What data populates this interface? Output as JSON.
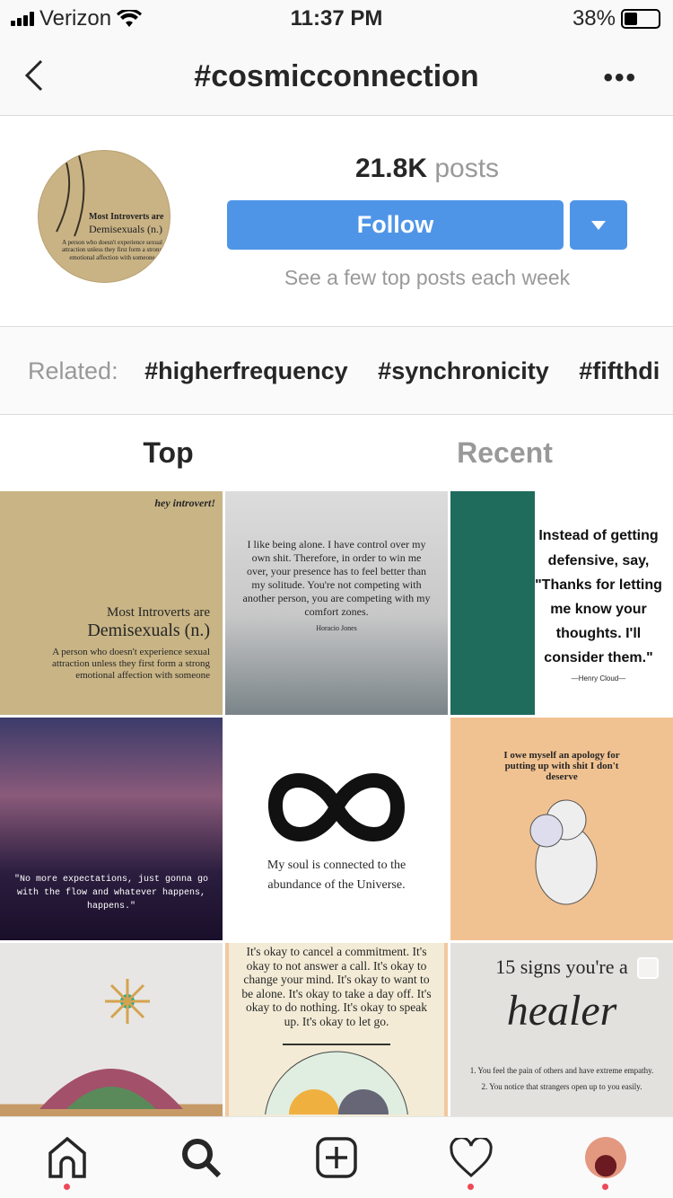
{
  "status_bar": {
    "carrier": "Verizon",
    "time": "11:37 PM",
    "battery": "38%",
    "battery_level": 0.38
  },
  "header": {
    "title": "#cosmicconnection",
    "back_icon": "chevron-left-icon",
    "more_icon": "ellipsis-icon"
  },
  "profile": {
    "avatar_text": [
      "Most Introverts are",
      "Demisexuals (n.)",
      "A person who doesn't experience sexual attraction unless they first form a strong emotional affection with someone"
    ],
    "post_count": "21.8K",
    "posts_label": "posts",
    "follow_label": "Follow",
    "subtitle": "See a few top posts each week",
    "accent": "#4e95e8"
  },
  "related": {
    "label": "Related:",
    "tags": [
      "#higherfrequency",
      "#synchronicity",
      "#fifthdi"
    ]
  },
  "tabs": [
    {
      "label": "Top",
      "active": true
    },
    {
      "label": "Recent",
      "active": false
    }
  ],
  "grid": [
    {
      "tag": "hey introvert!",
      "title": "Most Introverts are",
      "title2": "Demisexuals (n.)",
      "text": "A person who doesn't experience sexual attraction unless they first form a strong emotional affection with someone"
    },
    {
      "text": "I like being alone. I have control over my own shit. Therefore, in order to win me over, your presence has to feel better than my solitude. You're not competing with another person, you are competing with my comfort zones.",
      "author": "Horacio Jones"
    },
    {
      "text": "Instead of getting defensive, say, \"Thanks for letting me know your thoughts. I'll consider them.\"",
      "author": "—Henry Cloud—"
    },
    {
      "text": "\"No more expectations, just gonna go with the flow and whatever happens, happens.\""
    },
    {
      "text": "My soul is connected to the abundance of the Universe."
    },
    {
      "text": "I owe myself an apology for putting up with shit I don't deserve"
    },
    {
      "text": ""
    },
    {
      "text": "It's okay to cancel a commitment. It's okay to not answer a call. It's okay to change your mind. It's okay to want to be alone. It's okay to take a day off. It's okay to do nothing. It's okay to speak up. It's okay to let go."
    },
    {
      "title": "15 signs you're a",
      "script": "healer",
      "line1": "1. You feel the pain of others and have extreme empathy.",
      "line2": "2. You notice that strangers open up to you easily."
    }
  ],
  "nav": {
    "items": [
      "home-icon",
      "search-icon",
      "new-post-icon",
      "activity-heart-icon",
      "profile-avatar"
    ]
  }
}
